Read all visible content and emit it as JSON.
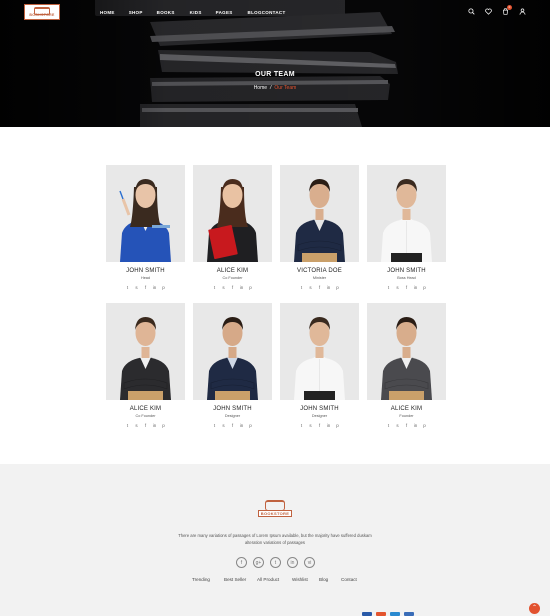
{
  "header": {
    "logo_text": "BOOKSTORE",
    "nav": [
      "HOME",
      "SHOP",
      "BOOKS",
      "KIDS",
      "PAGES",
      "BLOG",
      "CONTACT"
    ],
    "cart_count": "0"
  },
  "hero": {
    "title": "OUR TEAM",
    "breadcrumb_home": "Home",
    "breadcrumb_sep": "/",
    "breadcrumb_current": "Our Team"
  },
  "team": [
    {
      "name": "JOHN SMITH",
      "role": "Head"
    },
    {
      "name": "ALICE KIM",
      "role": "Co Founder"
    },
    {
      "name": "VICTORIA DOE",
      "role": "Minister"
    },
    {
      "name": "JOHN SMITH",
      "role": "Boss Head"
    },
    {
      "name": "ALICE KIM",
      "role": "Co Founder"
    },
    {
      "name": "JOHN SMITH",
      "role": "Designer"
    },
    {
      "name": "JOHN SMITH",
      "role": "Designer"
    },
    {
      "name": "ALICE KIM",
      "role": "Founder"
    }
  ],
  "social_icons": [
    "twitter-icon",
    "skype-icon",
    "facebook-icon",
    "linkedin-icon",
    "pinterest-icon"
  ],
  "footer": {
    "logo_text": "BOOKSTORE",
    "description": "There are many variations of passages of Lorem Ipsum available, but the majority have suffered duskam alteration variations of passages",
    "social": [
      "f",
      "g+",
      "t",
      "in",
      "vi"
    ],
    "links": [
      "Trending",
      "Best Seller",
      "All Product",
      "Wishlist",
      "Blog",
      "Contact"
    ]
  },
  "colors": {
    "accent": "#e2522f",
    "brand": "#c0623f",
    "footer_bg": "#f2f2f2"
  }
}
